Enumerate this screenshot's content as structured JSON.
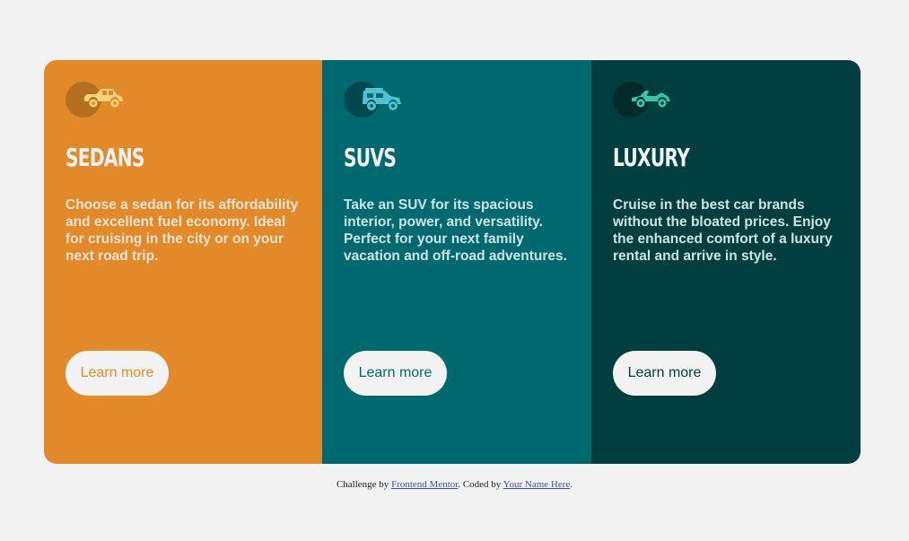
{
  "cards": [
    {
      "title": "SEDANS",
      "description": "Choose a sedan for its affordability and excellent fuel economy. Ideal for cruising in the city or on your next road trip.",
      "button_label": "Learn more",
      "icon": "sedan-car-icon",
      "icon_color": "#fbd17a"
    },
    {
      "title": "SUVS",
      "description": "Take an SUV for its spacious interior, power, and versatility. Perfect for your next family vacation and off-road adventures.",
      "button_label": "Learn more",
      "icon": "suv-car-icon",
      "icon_color": "#4fc1d3"
    },
    {
      "title": "LUXURY",
      "description": "Cruise in the best car brands without the bloated prices. Enjoy the enhanced comfort of a luxury rental and arrive in style.",
      "button_label": "Learn more",
      "icon": "luxury-car-icon",
      "icon_color": "#35c7a9"
    }
  ],
  "attribution": {
    "prefix": "Challenge by",
    "link1": "Frontend Mentor",
    "middle": ". Coded by",
    "link2": "Your Name Here",
    "suffix": "."
  },
  "colors": {
    "background": "#f2f2f2",
    "orange": "#e28a2a",
    "teal": "#006970",
    "dark_cyan": "#013e3f"
  }
}
